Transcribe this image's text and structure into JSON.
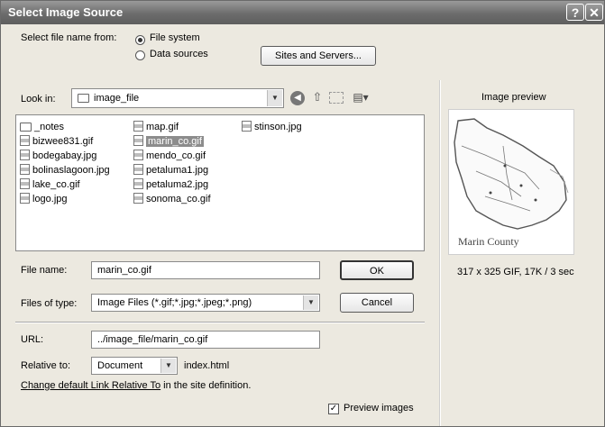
{
  "dialog": {
    "title": "Select Image Source",
    "help_icon": "question-mark-icon",
    "close_icon": "close-x-icon"
  },
  "source": {
    "label": "Select file name from:",
    "options": [
      "File system",
      "Data sources"
    ],
    "selected": "File system",
    "sites_button": "Sites and Servers..."
  },
  "lookin": {
    "label": "Look in:",
    "folder": "image_file"
  },
  "toolbar": {
    "icons": [
      "back-icon",
      "up-folder-icon",
      "new-folder-icon",
      "view-menu-icon"
    ]
  },
  "files": [
    {
      "name": "_notes",
      "type": "folder"
    },
    {
      "name": "bizwee831.gif",
      "type": "image"
    },
    {
      "name": "bodegabay.jpg",
      "type": "image"
    },
    {
      "name": "bolinaslagoon.jpg",
      "type": "image"
    },
    {
      "name": "lake_co.gif",
      "type": "image"
    },
    {
      "name": "logo.jpg",
      "type": "image"
    },
    {
      "name": "map.gif",
      "type": "image"
    },
    {
      "name": "marin_co.gif",
      "type": "image",
      "selected": true
    },
    {
      "name": "mendo_co.gif",
      "type": "image"
    },
    {
      "name": "petaluma1.jpg",
      "type": "image"
    },
    {
      "name": "petaluma2.jpg",
      "type": "image"
    },
    {
      "name": "sonoma_co.gif",
      "type": "image"
    },
    {
      "name": "stinson.jpg",
      "type": "image"
    }
  ],
  "filename": {
    "label": "File name:",
    "value": "marin_co.gif"
  },
  "filetype": {
    "label": "Files of type:",
    "value": "Image Files (*.gif;*.jpg;*.jpeg;*.png)"
  },
  "buttons": {
    "ok": "OK",
    "cancel": "Cancel"
  },
  "url": {
    "label": "URL:",
    "value": "../image_file/marin_co.gif"
  },
  "relative": {
    "label": "Relative to:",
    "value": "Document",
    "page": "index.html"
  },
  "link": {
    "text": "Change default Link Relative To",
    "suffix": " in the site definition."
  },
  "preview": {
    "heading": "Image preview",
    "caption": "Marin County",
    "info": "317 x 325 GIF, 17K / 3 sec",
    "checkbox_label": "Preview images",
    "checked": true
  }
}
